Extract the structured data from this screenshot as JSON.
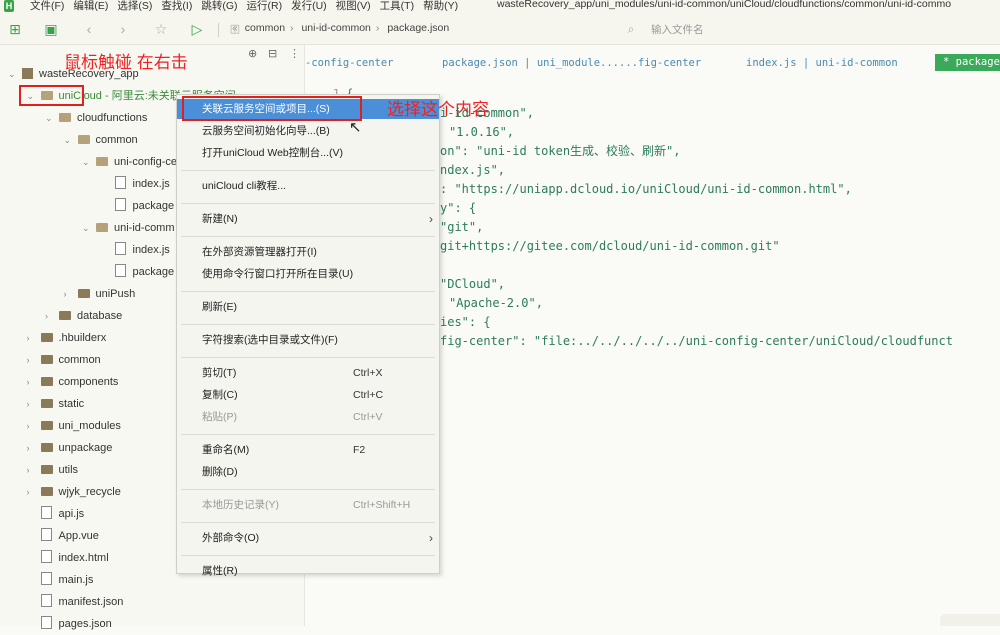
{
  "menubar": {
    "items": [
      "文件(F)",
      "编辑(E)",
      "选择(S)",
      "查找(I)",
      "跳转(G)",
      "运行(R)",
      "发行(U)",
      "视图(V)",
      "工具(T)",
      "帮助(Y)"
    ],
    "path": "wasteRecovery_app/uni_modules/uni-id-common/uniCloud/cloudfunctions/common/uni-id-commo"
  },
  "toolbar": {
    "breadcrumb": [
      "common",
      "uni-id-common",
      "package.json"
    ],
    "file_search_placeholder": "输入文件名"
  },
  "tree": [
    {
      "label": "wasteRecovery_app",
      "depth": 0,
      "type": "project",
      "expanded": true
    },
    {
      "label": "uniCloud - 阿里云:未关联云服务空间",
      "depth": 1,
      "type": "folder",
      "expanded": true
    },
    {
      "label": "cloudfunctions",
      "depth": 2,
      "type": "folder",
      "expanded": true
    },
    {
      "label": "common",
      "depth": 3,
      "type": "folder",
      "expanded": true
    },
    {
      "label": "uni-config-ce",
      "depth": 4,
      "type": "folder",
      "expanded": true
    },
    {
      "label": "index.js",
      "depth": 5,
      "type": "file"
    },
    {
      "label": "package",
      "depth": 5,
      "type": "file"
    },
    {
      "label": "uni-id-comm",
      "depth": 4,
      "type": "folder",
      "expanded": true
    },
    {
      "label": "index.js",
      "depth": 5,
      "type": "file"
    },
    {
      "label": "package",
      "depth": 5,
      "type": "file"
    },
    {
      "label": "uniPush",
      "depth": 3,
      "type": "folder",
      "expanded": false
    },
    {
      "label": "database",
      "depth": 2,
      "type": "folder",
      "expanded": false
    },
    {
      "label": ".hbuilderx",
      "depth": 1,
      "type": "folder",
      "expanded": false
    },
    {
      "label": "common",
      "depth": 1,
      "type": "folder",
      "expanded": false
    },
    {
      "label": "components",
      "depth": 1,
      "type": "folder",
      "expanded": false
    },
    {
      "label": "static",
      "depth": 1,
      "type": "folder",
      "expanded": false
    },
    {
      "label": "uni_modules",
      "depth": 1,
      "type": "folder",
      "expanded": false
    },
    {
      "label": "unpackage",
      "depth": 1,
      "type": "folder",
      "expanded": false
    },
    {
      "label": "utils",
      "depth": 1,
      "type": "folder",
      "expanded": false
    },
    {
      "label": "wjyk_recycle",
      "depth": 1,
      "type": "folder",
      "expanded": false
    },
    {
      "label": "api.js",
      "depth": 1,
      "type": "file"
    },
    {
      "label": "App.vue",
      "depth": 1,
      "type": "file"
    },
    {
      "label": "index.html",
      "depth": 1,
      "type": "file"
    },
    {
      "label": "main.js",
      "depth": 1,
      "type": "file"
    },
    {
      "label": "manifest.json",
      "depth": 1,
      "type": "file"
    },
    {
      "label": "pages.json",
      "depth": 1,
      "type": "file"
    }
  ],
  "annotations": {
    "hover_note": "鼠标触碰 在右击",
    "select_note": "选择这个内容"
  },
  "editor": {
    "tabs": [
      "-config-center",
      "package.json | uni_module......fig-center",
      "index.js | uni-id-common"
    ],
    "active_tab": "* package",
    "code_lines": [
      {
        "ln": "1",
        "text": "{"
      },
      {
        "ln": "",
        "text": "i-id-common\","
      },
      {
        "ln": "",
        "text": "\"1.0.16\","
      },
      {
        "ln": "",
        "text": "on\": \"uni-id token生成、校验、刷新\","
      },
      {
        "ln": "",
        "text": "ndex.js\","
      },
      {
        "ln": "",
        "text": ": \"https://uniapp.dcloud.io/uniCloud/uni-id-common.html\","
      },
      {
        "ln": "",
        "text": "y\": {"
      },
      {
        "ln": "",
        "text": "\"git\","
      },
      {
        "ln": "",
        "text": "git+https://gitee.com/dcloud/uni-id-common.git\""
      },
      {
        "ln": "",
        "text": ""
      },
      {
        "ln": "",
        "text": "\"DCloud\","
      },
      {
        "ln": "",
        "text": "\"Apache-2.0\","
      },
      {
        "ln": "",
        "text": "ies\": {"
      },
      {
        "ln": "",
        "text": "fig-center\": \"file:../../../../../uni-config-center/uniCloud/cloudfunct"
      }
    ]
  },
  "context_menu": {
    "items": [
      {
        "label": "关联云服务空间或项目...(S)",
        "shortcut": "",
        "highlight": true
      },
      {
        "label": "云服务空间初始化向导...(B)",
        "shortcut": ""
      },
      {
        "label": "打开uniCloud Web控制台...(V)",
        "shortcut": ""
      },
      {
        "sep": true
      },
      {
        "label": "uniCloud cli教程...",
        "shortcut": ""
      },
      {
        "sep": true
      },
      {
        "label": "新建(N)",
        "shortcut": "",
        "submenu": true
      },
      {
        "sep": true
      },
      {
        "label": "在外部资源管理器打开(I)",
        "shortcut": ""
      },
      {
        "label": "使用命令行窗口打开所在目录(U)",
        "shortcut": ""
      },
      {
        "sep": true
      },
      {
        "label": "刷新(E)",
        "shortcut": ""
      },
      {
        "sep": true
      },
      {
        "label": "字符搜索(选中目录或文件)(F)",
        "shortcut": ""
      },
      {
        "sep": true
      },
      {
        "label": "剪切(T)",
        "shortcut": "Ctrl+X"
      },
      {
        "label": "复制(C)",
        "shortcut": "Ctrl+C"
      },
      {
        "label": "粘贴(P)",
        "shortcut": "Ctrl+V",
        "disabled": true
      },
      {
        "sep": true
      },
      {
        "label": "重命名(M)",
        "shortcut": "F2"
      },
      {
        "label": "删除(D)",
        "shortcut": ""
      },
      {
        "sep": true
      },
      {
        "label": "本地历史记录(Y)",
        "shortcut": "Ctrl+Shift+H",
        "disabled": true
      },
      {
        "sep": true
      },
      {
        "label": "外部命令(O)",
        "shortcut": "",
        "submenu": true
      },
      {
        "sep": true
      },
      {
        "label": "属性(R)",
        "shortcut": ""
      }
    ]
  },
  "colors": {
    "accent": "#3aaa5a",
    "highlight": "#4a8fd8",
    "annotation": "#ee2222"
  }
}
